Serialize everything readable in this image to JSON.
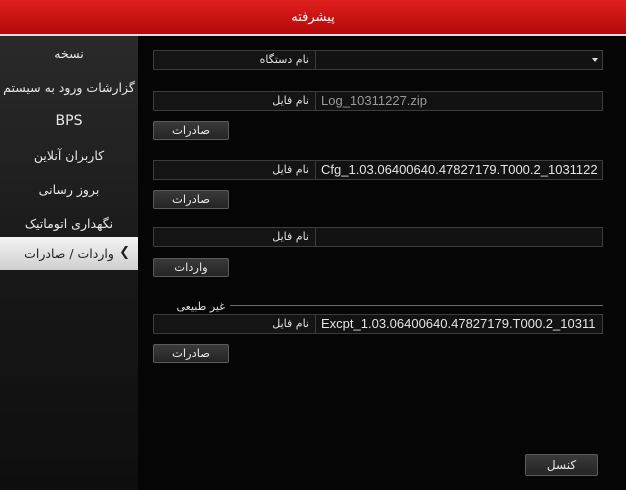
{
  "window": {
    "title": "پیشرفته"
  },
  "sidebar": {
    "items": [
      {
        "label": "نسخه"
      },
      {
        "label": "گزارشات ورود به سیستم"
      },
      {
        "label": "BPS"
      },
      {
        "label": "کاربران آنلاین"
      },
      {
        "label": "بروز رسانی"
      },
      {
        "label": "نگهداری اتوماتیک"
      },
      {
        "label": "واردات / صادرات",
        "selected": true
      }
    ],
    "active_icon": "chevron-left-icon"
  },
  "main": {
    "device": {
      "label": "نام دستگاه",
      "value": ""
    },
    "log": {
      "label": "نام فایل",
      "value": "Log_10311227.zip",
      "button": "صادرات"
    },
    "config_export": {
      "label": "نام فایل",
      "value": "Cfg_1.03.06400640.47827179.T000.2_1031122",
      "button": "صادرات"
    },
    "config_import": {
      "label": "نام فایل",
      "value": "",
      "button": "واردات"
    },
    "abnormal": {
      "group_title": "غیر طبیعی",
      "label": "نام فایل",
      "value": "Excpt_1.03.06400640.47827179.T000.2_10311",
      "button": "صادرات"
    }
  },
  "footer": {
    "cancel_label": "کنسل"
  },
  "colors": {
    "title_bar": "#c80e0e",
    "active_item": "#e6e6e6"
  }
}
